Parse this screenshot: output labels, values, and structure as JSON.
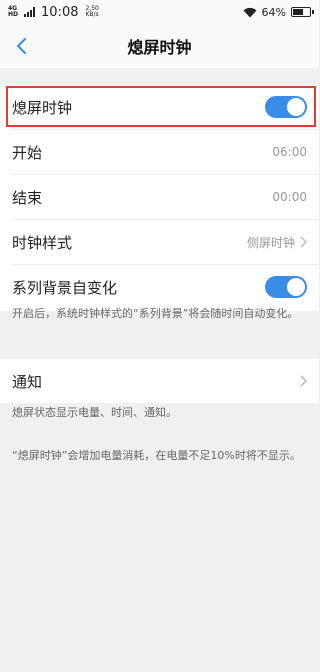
{
  "status_bar": {
    "network_type": "4G",
    "network_sub": "HD",
    "time": "10:08",
    "speed_value": "2.50",
    "speed_unit": "KB/s",
    "battery": "64%",
    "battery_level": 0.64
  },
  "header": {
    "title": "熄屏时钟",
    "back_icon": "chevron-left-icon"
  },
  "settings": {
    "aod_toggle": {
      "label": "熄屏时钟",
      "on": true
    },
    "start": {
      "label": "开始",
      "value": "06:00"
    },
    "end": {
      "label": "结束",
      "value": "00:00"
    },
    "clock_style": {
      "label": "时钟样式",
      "value": "侧屏时钟"
    },
    "series_bg": {
      "label": "系列背景自变化",
      "on": true
    },
    "series_bg_note": "开启后，系统时钟样式的“系列背景”将会随时间自动变化。",
    "notification": {
      "label": "通知"
    },
    "notification_note": "熄屏状态显示电量、时间、通知。",
    "power_note": "“熄屏时钟”会增加电量消耗，在电量不足10%时将不显示。"
  },
  "colors": {
    "accent": "#3b8ce6",
    "highlight": "#e53935"
  }
}
